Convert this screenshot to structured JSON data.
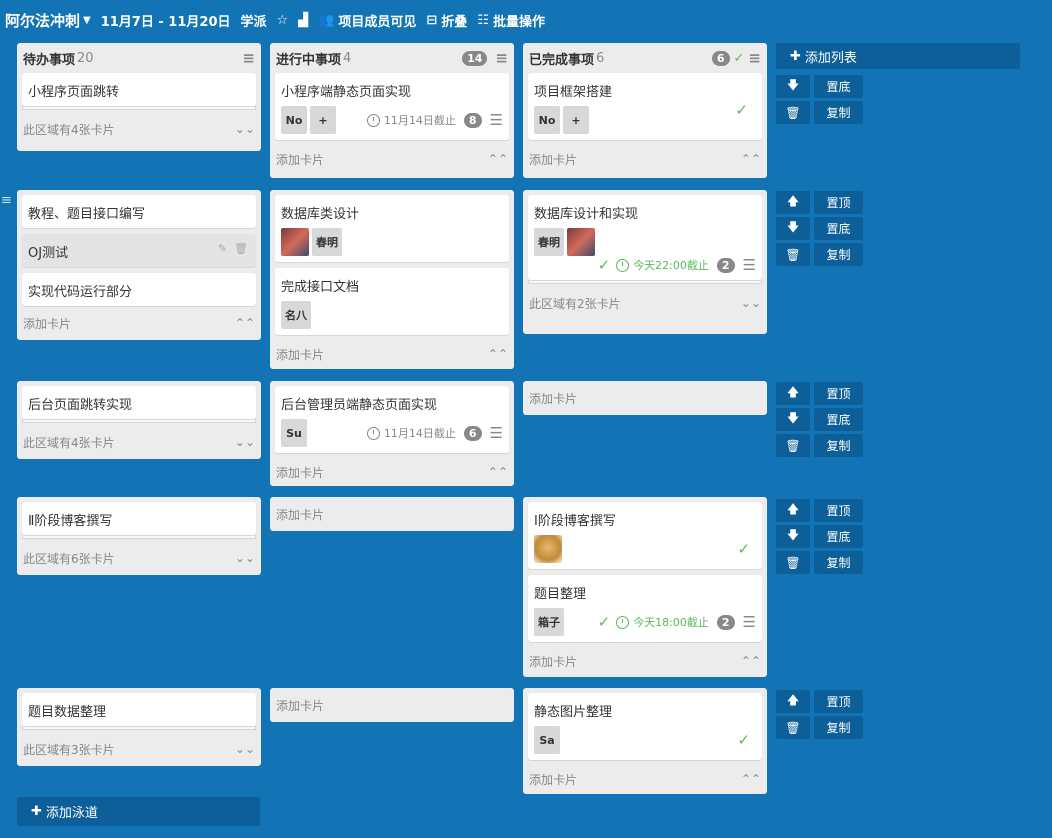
{
  "header": {
    "title": "阿尔法冲刺",
    "dates": "11月7日 - 11月20日",
    "team": "学派",
    "members_visible": "项目成员可见",
    "fold": "折叠",
    "batch": "批量操作"
  },
  "columns": {
    "todo": {
      "name": "待办事项",
      "count": "20"
    },
    "doing": {
      "name": "进行中事项",
      "count": "4",
      "badge": "14"
    },
    "done": {
      "name": "已完成事项",
      "count": "6",
      "badge": "6"
    }
  },
  "actions": {
    "add_list": "添加列表",
    "add_lane": "添加泳道",
    "add_card": "添加卡片",
    "top": "置顶",
    "bottom": "置底",
    "copy": "复制"
  },
  "lanes": [
    {
      "todo": {
        "cards": [
          {
            "title": "小程序页面跳转"
          }
        ],
        "collapsed": "此区域有4张卡片"
      },
      "doing": {
        "cards": [
          {
            "title": "小程序端静态页面实现",
            "chips": [
              "No",
              "+"
            ],
            "due": "11月14日截止",
            "num": "8"
          }
        ]
      },
      "done": {
        "cards": [
          {
            "title": "项目框架搭建",
            "chips": [
              "No",
              "+"
            ]
          }
        ]
      }
    },
    {
      "todo": {
        "cards": [
          {
            "title": "教程、题目接口编写"
          },
          {
            "title": "OJ测试"
          },
          {
            "title": "实现代码运行部分"
          }
        ]
      },
      "doing": {
        "cards": [
          {
            "title": "数据库类设计",
            "chips": [
              "春明"
            ]
          },
          {
            "title": "完成接口文档",
            "chips": [
              "名八"
            ]
          }
        ]
      },
      "done": {
        "cards": [
          {
            "title": "数据库设计和实现",
            "chips": [
              "春明"
            ],
            "due": "今天22:00截止",
            "num": "2"
          }
        ],
        "collapsed": "此区域有2张卡片"
      }
    },
    {
      "todo": {
        "cards": [
          {
            "title": "后台页面跳转实现"
          }
        ],
        "collapsed": "此区域有4张卡片"
      },
      "doing": {
        "cards": [
          {
            "title": "后台管理员端静态页面实现",
            "chips": [
              "Su"
            ],
            "due": "11月14日截止",
            "num": "6"
          }
        ]
      }
    },
    {
      "todo": {
        "cards": [
          {
            "title": "Ⅱ阶段博客撰写"
          }
        ],
        "collapsed": "此区域有6张卡片"
      },
      "done": {
        "cards": [
          {
            "title": "Ⅰ阶段博客撰写"
          },
          {
            "title": "题目整理",
            "chips": [
              "箱子"
            ],
            "due": "今天18:00截止",
            "num": "2"
          }
        ]
      }
    },
    {
      "todo": {
        "cards": [
          {
            "title": "题目数据整理"
          }
        ],
        "collapsed": "此区域有3张卡片"
      },
      "done": {
        "cards": [
          {
            "title": "静态图片整理",
            "chips": [
              "Sa"
            ]
          }
        ]
      }
    }
  ],
  "colors": {
    "background": "#1273b5",
    "button": "#0d5f99",
    "green": "#5cb85c"
  }
}
